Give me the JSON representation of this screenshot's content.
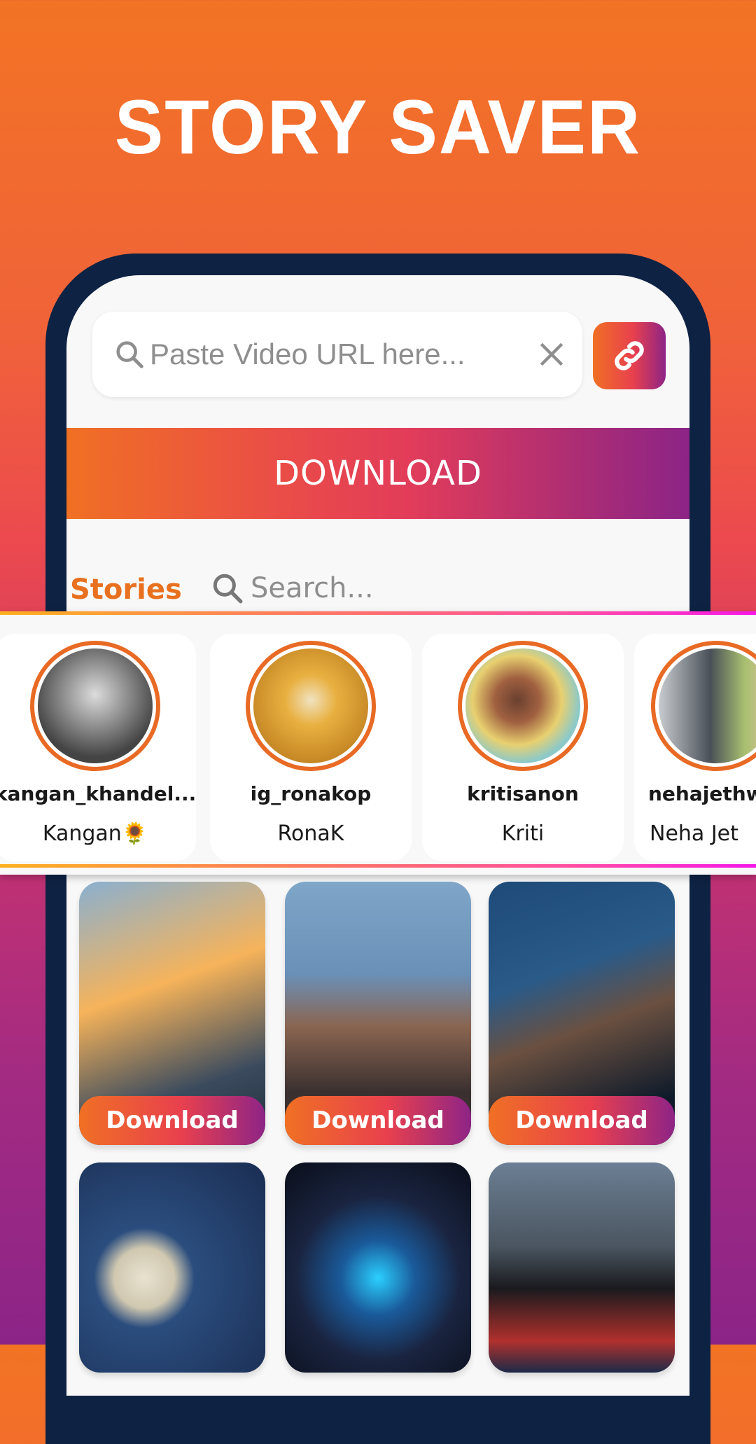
{
  "headline": "STORY SAVER",
  "url_input": {
    "placeholder": "Paste Video URL here...",
    "value": ""
  },
  "download_button": "DOWNLOAD",
  "stories_section": {
    "label": "Stories",
    "search_placeholder": "Search..."
  },
  "stories": [
    {
      "username": "kangan_khandel...",
      "name": "Kangan🌻",
      "avatar_color": "#777777"
    },
    {
      "username": "ig_ronakop",
      "name": "RonaK",
      "avatar_color": "#d89a2e"
    },
    {
      "username": "kritisanon",
      "name": "Kriti",
      "avatar_color": "#8cc9c8"
    },
    {
      "username": "nehajethw",
      "name": "Neha Jet",
      "avatar_color": "#9aa09a"
    }
  ],
  "grid": [
    {
      "button": "Download",
      "colors": [
        "#f6b35a",
        "#3b4b5e"
      ]
    },
    {
      "button": "Download",
      "colors": [
        "#7fa6c8",
        "#3a3030"
      ]
    },
    {
      "button": "Download",
      "colors": [
        "#2a5a88",
        "#0e1a2a"
      ]
    },
    {
      "button": "",
      "colors": [
        "#2b4d7e",
        "#1a2d52"
      ]
    },
    {
      "button": "",
      "colors": [
        "#1a2440",
        "#2ad0ff"
      ]
    },
    {
      "button": "",
      "colors": [
        "#6c7f94",
        "#b0302c"
      ]
    }
  ],
  "colors": {
    "brand_orange": "#f07024",
    "brand_pink": "#e8404e",
    "brand_purple": "#8e2486",
    "phone_frame": "#0e2243"
  }
}
